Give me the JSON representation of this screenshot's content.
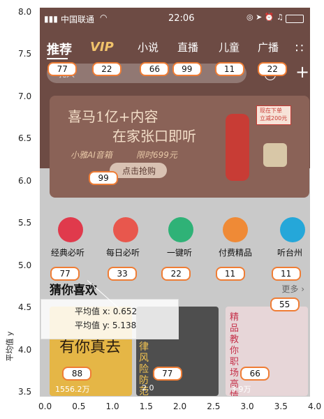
{
  "status_bar": {
    "carrier": "中国联通",
    "time": "22:06"
  },
  "nav_tabs": [
    "推荐",
    "VIP",
    "小说",
    "直播",
    "儿童",
    "广播"
  ],
  "search": {
    "placeholder": "乳人",
    "add_label": "+"
  },
  "banner": {
    "headline": "喜马1亿+内容",
    "subline": "在家张口即听",
    "product": "小雅AI音箱",
    "price_text": "限时699元",
    "cta": "点击抢购",
    "badge_line1": "现在下单",
    "badge_line2": "立减200元"
  },
  "categories": [
    "经典必听",
    "每日必听",
    "一键听",
    "付费精品",
    "听台州"
  ],
  "section": {
    "title": "猜你喜欢",
    "more": "更多"
  },
  "cards": [
    {
      "text": "有你真去",
      "plays": "1556.2万"
    },
    {
      "text": "律风险防范",
      "plays": "2.0"
    },
    {
      "text": "精品 教你职场高情",
      "plays": "3.9万"
    }
  ],
  "tooltip": {
    "line_x": "平均值 x: 0.652",
    "line_y": "平均值 y: 5.138"
  },
  "chart_data": {
    "type": "scatter",
    "title": "",
    "xlabel": "",
    "ylabel": "平均值 y",
    "xlim": [
      0.0,
      4.0
    ],
    "ylim": [
      3.5,
      8.0
    ],
    "x_ticks": [
      "0.0",
      "0.5",
      "1.0",
      "1.5",
      "2.0",
      "2.5",
      "3.0",
      "3.5",
      "4.0"
    ],
    "y_ticks": [
      "3.5",
      "4.0",
      "4.5",
      "5.0",
      "5.5",
      "6.0",
      "6.5",
      "7.0",
      "7.5",
      "8.0"
    ],
    "points": [
      {
        "x": 0.22,
        "y": 7.33,
        "label": "77"
      },
      {
        "x": 0.88,
        "y": 7.33,
        "label": "22"
      },
      {
        "x": 1.59,
        "y": 7.33,
        "label": "66"
      },
      {
        "x": 2.07,
        "y": 7.33,
        "label": "99"
      },
      {
        "x": 2.7,
        "y": 7.33,
        "label": "11"
      },
      {
        "x": 3.34,
        "y": 7.33,
        "label": "22"
      },
      {
        "x": 0.83,
        "y": 6.04,
        "label": "99"
      },
      {
        "x": 0.26,
        "y": 4.91,
        "label": "77"
      },
      {
        "x": 1.11,
        "y": 4.91,
        "label": "33"
      },
      {
        "x": 1.91,
        "y": 4.91,
        "label": "22"
      },
      {
        "x": 2.71,
        "y": 4.91,
        "label": "11"
      },
      {
        "x": 3.54,
        "y": 4.91,
        "label": "11"
      },
      {
        "x": 3.52,
        "y": 4.54,
        "label": "55"
      },
      {
        "x": 0.44,
        "y": 3.72,
        "label": "88"
      },
      {
        "x": 1.78,
        "y": 3.72,
        "label": "77"
      },
      {
        "x": 3.08,
        "y": 3.72,
        "label": "66"
      }
    ]
  }
}
